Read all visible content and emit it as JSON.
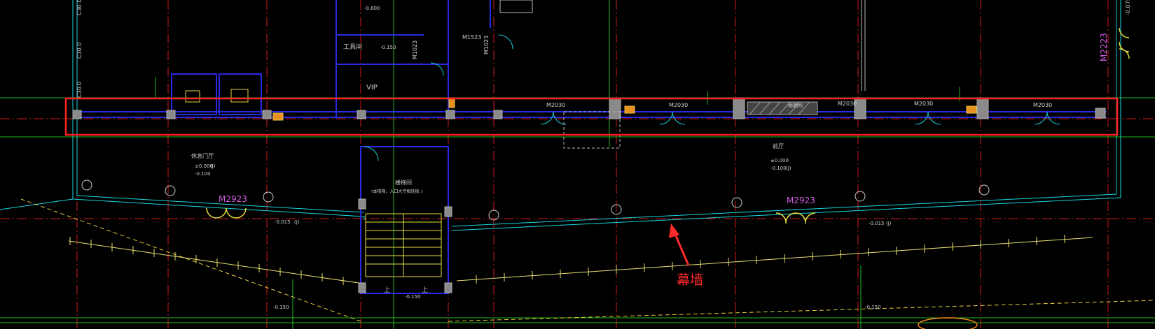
{
  "drawing": {
    "axis_labels": {
      "a": "C30.0",
      "b": "C30.0",
      "c": "C30.0",
      "right": "-0.075"
    },
    "doors": {
      "m2923_left": "M2923",
      "m2923_right": "M2923",
      "m2223": "M2223",
      "m2030_1": "M2030",
      "m2030_2": "M2030",
      "m2030_3": "M2030",
      "m2030_4": "M2030",
      "m1523": "M1523",
      "m1023": "M1023",
      "m1023b": "M1023",
      "m2030_top": "M2030"
    },
    "rooms": {
      "vip": "VIP",
      "tool_room": "工具间",
      "hall_left": "休息门厅",
      "hall_right": "前厅",
      "stair": "楼梯间",
      "stair_note": "(本楼梯，入口大厅相连接，)",
      "baggage": "雨棚间"
    },
    "elevations": {
      "e1": "±0.000",
      "e2": "-0.100",
      "e3": "±0.000",
      "e4": "-0.100",
      "e5": "-0.015",
      "e6": "-0.015",
      "e7": "-0.150",
      "e8": "-0.150",
      "e9": "-0.150",
      "e10": "-0.600",
      "e11": "-0.150"
    },
    "tags": {
      "j1": "(J)",
      "j2": "(J)",
      "j3": "(J)",
      "j4": "(J)",
      "u1": "上",
      "u2": "上"
    },
    "annotation": {
      "text": "幕墙",
      "color": "#ff2a2a"
    },
    "highlight_box_color": "#ff2020"
  }
}
